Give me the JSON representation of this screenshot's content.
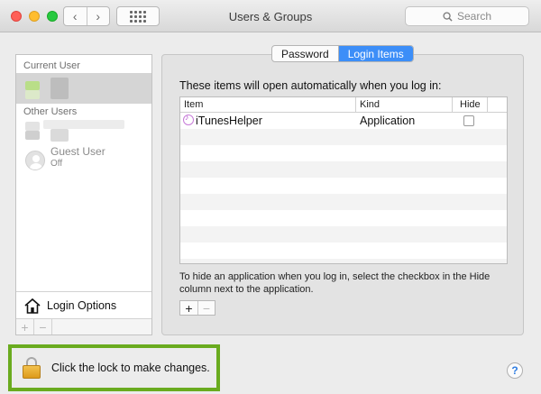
{
  "window": {
    "title": "Users & Groups",
    "back_glyph": "‹",
    "forward_glyph": "›"
  },
  "search": {
    "placeholder": "Search",
    "icon": "magnifier-icon"
  },
  "sidebar": {
    "current_user_header": "Current User",
    "other_users_header": "Other Users",
    "guest_user": {
      "name": "Guest User",
      "status": "Off"
    },
    "login_options_label": "Login Options",
    "add_glyph": "+",
    "remove_glyph": "−"
  },
  "tabs": [
    {
      "label": "Password",
      "active": false
    },
    {
      "label": "Login Items",
      "active": true
    }
  ],
  "login_items": {
    "intro": "These items will open automatically when you log in:",
    "columns": {
      "item": "Item",
      "kind": "Kind",
      "hide": "Hide"
    },
    "rows": [
      {
        "item": "iTunesHelper",
        "kind": "Application",
        "hide": false,
        "icon": "itunes-icon"
      }
    ],
    "help_text": "To hide an application when you log in, select the checkbox in the Hide column next to the application.",
    "add_glyph": "+",
    "remove_glyph": "−"
  },
  "lock": {
    "text": "Click the lock to make changes.",
    "highlight_color": "#6aab1f"
  },
  "help_button": {
    "glyph": "?"
  },
  "colors": {
    "accent": "#3c8ef8",
    "close": "#ff5f57",
    "minimize": "#ffbd2e",
    "zoom": "#28c940"
  }
}
